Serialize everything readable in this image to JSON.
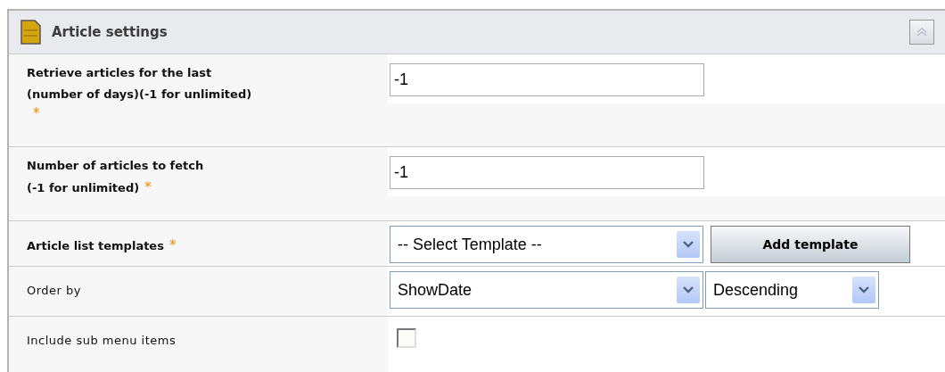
{
  "panel": {
    "title": "Article settings",
    "collapsed": false,
    "fields": [
      {
        "kind": "text",
        "label_lines": [
          "Retrieve articles for the last",
          "(number of days)(-1 for unlimited)"
        ],
        "bold": true,
        "required_mark": "*",
        "mark_below": true,
        "value": "-1"
      },
      {
        "kind": "text",
        "label_lines": [
          "Number of articles to fetch",
          "(-1 for unlimited)"
        ],
        "bold": true,
        "required_mark": "*",
        "mark_below": false,
        "value": "-1"
      },
      {
        "kind": "select_button",
        "label_lines": [
          "Article list templates"
        ],
        "bold": true,
        "required_mark": "*",
        "mark_below": false,
        "select": "-- Select Template --",
        "button": "Add template"
      },
      {
        "kind": "two_selects",
        "label_lines": [
          "Order by"
        ],
        "bold": false,
        "select": "ShowDate",
        "select2": "Descending"
      },
      {
        "kind": "checkbox",
        "label_lines": [
          "Include sub menu items"
        ],
        "bold": false,
        "checked": false
      }
    ]
  }
}
